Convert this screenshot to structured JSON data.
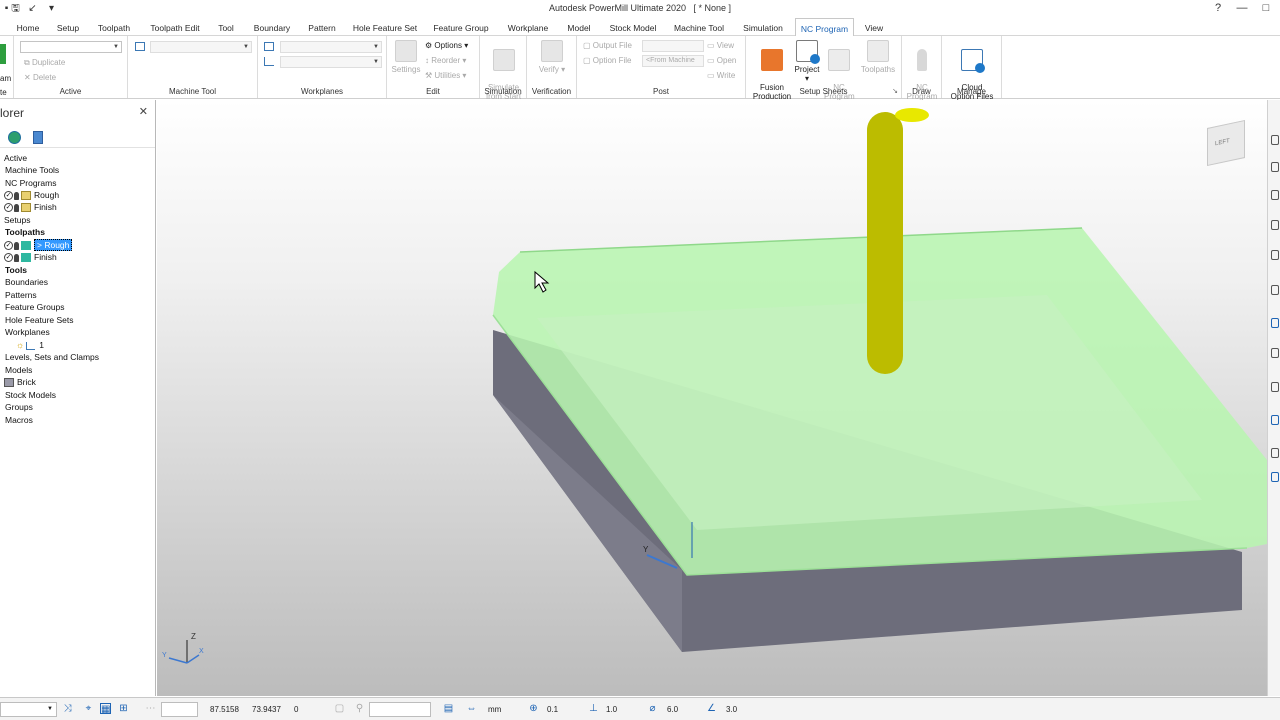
{
  "window": {
    "title": "Autodesk PowerMill Ultimate 2020",
    "doc": "[ * None ]"
  },
  "tabs": [
    "Home",
    "Setup",
    "Toolpath",
    "Toolpath Edit",
    "Tool",
    "Boundary",
    "Pattern",
    "Hole Feature Set",
    "Feature Group",
    "Workplane",
    "Model",
    "Stock Model",
    "Machine Tool",
    "Simulation",
    "NC Program",
    "View"
  ],
  "active_tab": "NC Program",
  "ribbon": {
    "groups": {
      "active": "Active",
      "machine_tool": "Machine Tool",
      "workplanes": "Workplanes",
      "edit": "Edit",
      "simulation": "Simulation",
      "verification": "Verification",
      "post": "Post",
      "setup_sheets": "Setup Sheets",
      "draw": "Draw",
      "manage": "Manage"
    },
    "program_cmd": "am",
    "create_cmd": "te",
    "duplicate": "Duplicate",
    "delete": "Delete",
    "settings": "Settings",
    "options": "Options",
    "reorder": "Reorder",
    "utilities": "Utilities",
    "simulate_from_start": "Simulate\nfrom Start",
    "verify": "Verify",
    "output_file": "Output File",
    "option_file": "Option File",
    "from_machine": "<From Machine",
    "view": "View",
    "open": "Open",
    "write": "Write",
    "fusion_production": "Fusion\nProduction",
    "project": "Project",
    "nc_program": "NC\nProgram",
    "toolpaths": "Toolpaths",
    "nc_program_draw": "NC\nProgram",
    "cloud_option_files": "Cloud\nOption Files"
  },
  "explorer": {
    "title": "lorer",
    "items": [
      {
        "label": "Active",
        "bold": false
      },
      {
        "label": "Machine Tools",
        "bold": false
      },
      {
        "label": "NC Programs",
        "bold": false
      },
      {
        "label": "Rough",
        "bold": false
      },
      {
        "label": "Finish",
        "bold": false
      },
      {
        "label": "Setups",
        "bold": false
      },
      {
        "label": "Toolpaths",
        "bold": true
      },
      {
        "label": "> Rough",
        "bold": false
      },
      {
        "label": "Finish",
        "bold": false
      },
      {
        "label": "Tools",
        "bold": true
      },
      {
        "label": "Boundaries",
        "bold": false
      },
      {
        "label": "Patterns",
        "bold": false
      },
      {
        "label": "Feature Groups",
        "bold": false
      },
      {
        "label": "Hole Feature Sets",
        "bold": false
      },
      {
        "label": "Workplanes",
        "bold": false
      },
      {
        "label": "1",
        "bold": false
      },
      {
        "label": "Levels, Sets and Clamps",
        "bold": false
      },
      {
        "label": "Models",
        "bold": false
      },
      {
        "label": "Brick",
        "bold": false
      },
      {
        "label": "Stock Models",
        "bold": false
      },
      {
        "label": "Groups",
        "bold": false
      },
      {
        "label": "Macros",
        "bold": false
      }
    ]
  },
  "viewport": {
    "viewcube_label": "LEFT",
    "axis_y": "Y",
    "triad_z": "Z",
    "triad_x": "X",
    "triad_y": "Y",
    "colors": {
      "stock": "#6c6c7a",
      "toolpath": "#b8f5b0",
      "tool": "#c8c800"
    }
  },
  "status": {
    "x": "87.5158",
    "y": "73.9437",
    "z": "0",
    "units": "mm",
    "tolerance": "0.1",
    "stepover": "1.0",
    "diameter": "6.0",
    "angle": "3.0"
  }
}
